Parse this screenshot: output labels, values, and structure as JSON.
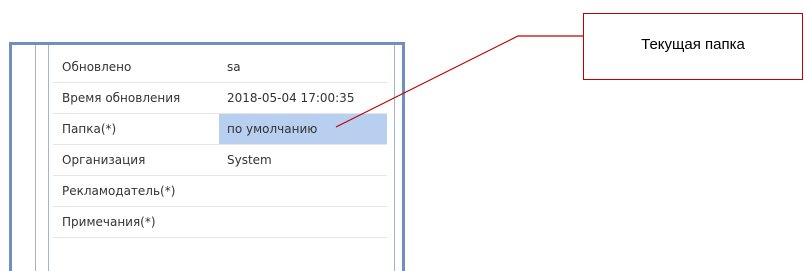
{
  "form": {
    "rows": [
      {
        "label": "Обновлено",
        "value": "sa"
      },
      {
        "label": "Время обновления",
        "value": "2018-05-04 17:00:35"
      },
      {
        "label": "Папка(*)",
        "value": "по умолчанию"
      },
      {
        "label": "Организация",
        "value": "System"
      },
      {
        "label": "Рекламодатель(*)",
        "value": ""
      },
      {
        "label": "Примечания(*)",
        "value": ""
      }
    ],
    "selected_row_color": "#b8cff0",
    "panel_border_color": "#6f8fbe"
  },
  "callout": {
    "text": "Текущая папка",
    "border_color": "#c00000"
  }
}
